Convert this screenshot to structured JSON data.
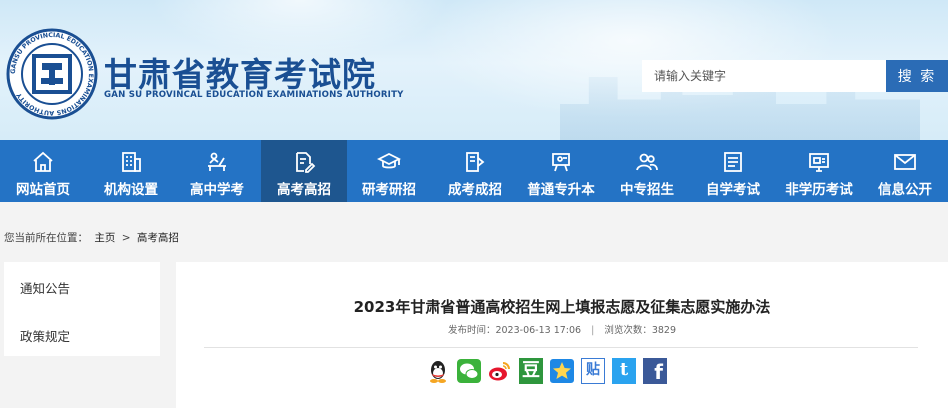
{
  "header": {
    "title": "甘肃省教育考试院",
    "subtitle": "GAN SU PROVINCAL EDUCATION EXAMINATIONS AUTHORITY",
    "emblem_text": "GANSU PROVINCIAL EDUCATION EXAMINATIONS AUTHORITY",
    "search_placeholder": "请输入关键字",
    "search_button": "搜 索"
  },
  "nav": {
    "items": [
      {
        "label": "网站首页",
        "icon": "home-icon"
      },
      {
        "label": "机构设置",
        "icon": "building-icon"
      },
      {
        "label": "高中学考",
        "icon": "writing-desk-icon"
      },
      {
        "label": "高考高招",
        "icon": "document-pen-icon",
        "active": true
      },
      {
        "label": "研考研招",
        "icon": "graduation-cap-icon"
      },
      {
        "label": "成考成招",
        "icon": "book-icon"
      },
      {
        "label": "普通专升本",
        "icon": "lecture-board-icon"
      },
      {
        "label": "中专招生",
        "icon": "people-icon"
      },
      {
        "label": "自学考试",
        "icon": "list-icon"
      },
      {
        "label": "非学历考试",
        "icon": "monitor-icon"
      },
      {
        "label": "信息公开",
        "icon": "mail-icon"
      }
    ]
  },
  "breadcrumb": {
    "prefix": "您当前所在位置：",
    "home": "主页",
    "separator": ">",
    "current": "高考高招"
  },
  "sidebar": {
    "items": [
      "通知公告",
      "政策规定"
    ]
  },
  "article": {
    "title": "2023年甘肃省普通高校招生网上填报志愿及征集志愿实施办法",
    "publish_label": "发布时间：2023-06-13 17:06",
    "separator": "|",
    "views_label": "浏览次数：3829"
  },
  "share": {
    "icons": [
      "qq-icon",
      "wechat-icon",
      "weibo-icon",
      "douban-icon",
      "qzone-icon",
      "tieba-icon",
      "twitter-icon",
      "facebook-icon"
    ],
    "douban_char": "豆",
    "tieba_char": "贴",
    "twitter_char": "t",
    "facebook_char": "f"
  },
  "colors": {
    "brand_blue": "#1a4f93",
    "nav_blue": "#2473c5",
    "nav_active": "#1e568f",
    "search_button": "#2b6cb6"
  }
}
